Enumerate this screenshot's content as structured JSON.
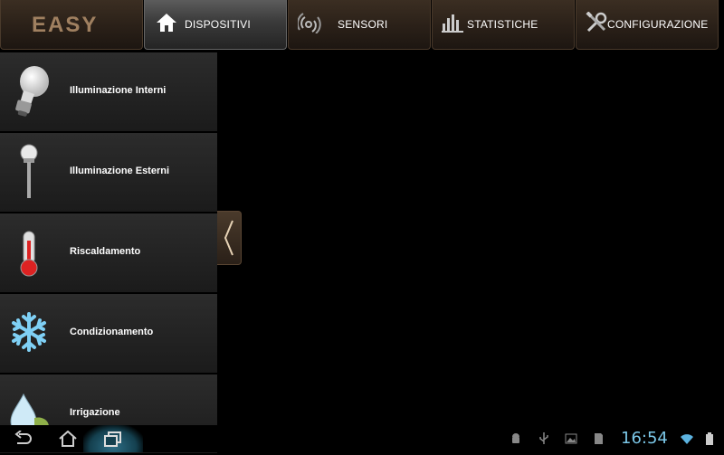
{
  "app": {
    "logo_text": "EASY"
  },
  "tabs": [
    {
      "label": "DISPOSITIVI",
      "icon": "home-icon",
      "active": true
    },
    {
      "label": "SENSORI",
      "icon": "sensor-icon",
      "active": false
    },
    {
      "label": "STATISTICHE",
      "icon": "bar-chart-icon",
      "active": false
    },
    {
      "label": "CONFIGURAZIONE",
      "icon": "tools-icon",
      "active": false
    }
  ],
  "sidebar": {
    "items": [
      {
        "label": "Illuminazione Interni",
        "icon": "light-bulb-icon"
      },
      {
        "label": "Illuminazione Esterni",
        "icon": "street-lamp-icon"
      },
      {
        "label": "Riscaldamento",
        "icon": "thermometer-icon"
      },
      {
        "label": "Condizionamento",
        "icon": "snowflake-icon"
      },
      {
        "label": "Irrigazione",
        "icon": "water-drop-icon"
      }
    ]
  },
  "system_bar": {
    "time": "16:54",
    "buttons": [
      "back-icon",
      "home-icon",
      "recent-apps-icon"
    ],
    "status_icons": [
      "android-icon",
      "usb-icon",
      "gallery-icon",
      "sd-card-icon",
      "wifi-icon",
      "battery-icon"
    ]
  },
  "colors": {
    "accent_brown": "#3b2e22",
    "clock_blue": "#7bc7e8"
  }
}
